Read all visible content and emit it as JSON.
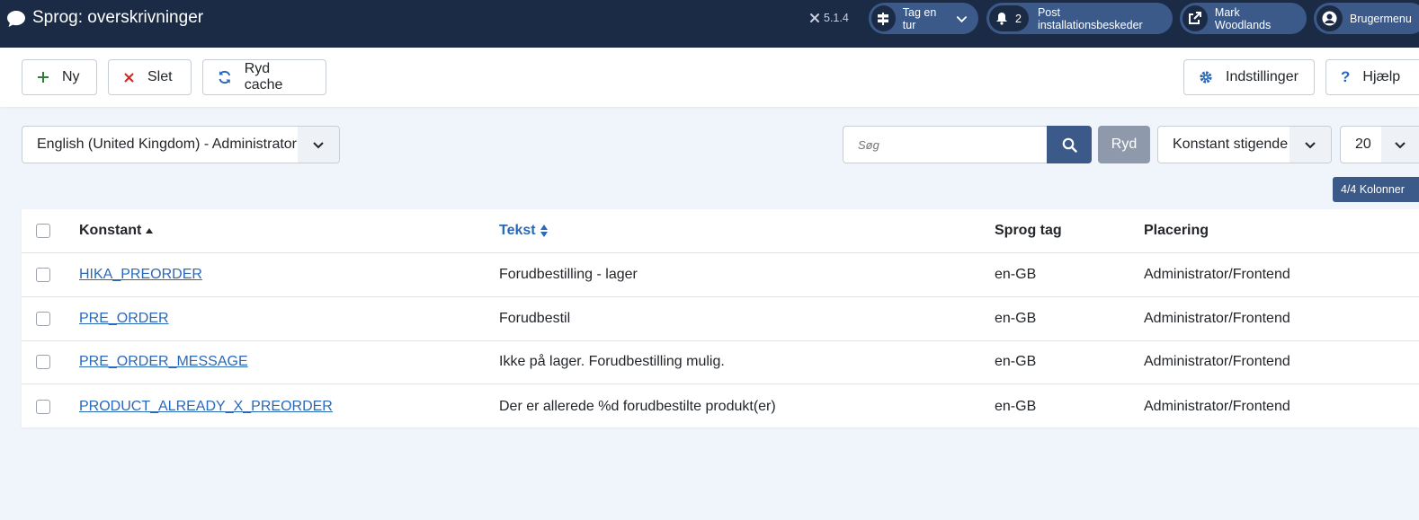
{
  "header": {
    "title": "Sprog: overskrivninger",
    "version": "5.1.4",
    "tour_label": "Tag en tur",
    "notifications_count": "2",
    "post_install_label": "Post installationsbeskeder",
    "site_label": "Mark Woodlands",
    "user_menu_label": "Brugermenu"
  },
  "toolbar": {
    "new_label": "Ny",
    "delete_label": "Slet",
    "clear_cache_label": "Ryd cache",
    "options_label": "Indstillinger",
    "help_label": "Hjælp"
  },
  "filters": {
    "language_selected": "English (United Kingdom) - Administrator",
    "search_placeholder": "Søg",
    "clear_label": "Ryd",
    "sort_selected": "Konstant stigende",
    "limit_selected": "20",
    "columns_label": "4/4 Kolonner"
  },
  "table": {
    "headers": {
      "constant": "Konstant",
      "text": "Tekst",
      "language_tag": "Sprog tag",
      "location": "Placering"
    },
    "rows": [
      {
        "constant": "HIKA_PREORDER",
        "text": "Forudbestilling - lager",
        "tag": "en-GB",
        "location": "Administrator/Frontend"
      },
      {
        "constant": "PRE_ORDER",
        "text": "Forudbestil",
        "tag": "en-GB",
        "location": "Administrator/Frontend"
      },
      {
        "constant": "PRE_ORDER_MESSAGE",
        "text": "Ikke på lager. Forudbestilling mulig.",
        "tag": "en-GB",
        "location": "Administrator/Frontend"
      },
      {
        "constant": "PRODUCT_ALREADY_X_PREORDER",
        "text": "Der er allerede %d forudbestilte produkt(er)",
        "tag": "en-GB",
        "location": "Administrator/Frontend"
      }
    ]
  },
  "colors": {
    "header_bg": "#1c2b45",
    "pill_bg": "#3b5a89",
    "link": "#2a69b8",
    "page_bg": "#f0f4fb"
  },
  "icons": {
    "logo": "speech-bubble-icon",
    "version": "joomla-icon",
    "tour": "signpost-icon",
    "notifications": "bell-icon",
    "site": "external-link-icon",
    "user": "user-circle-icon",
    "new": "plus-icon",
    "delete": "x-icon",
    "clear_cache": "refresh-icon",
    "options": "gear-icon",
    "help": "question-icon",
    "search": "search-icon"
  }
}
